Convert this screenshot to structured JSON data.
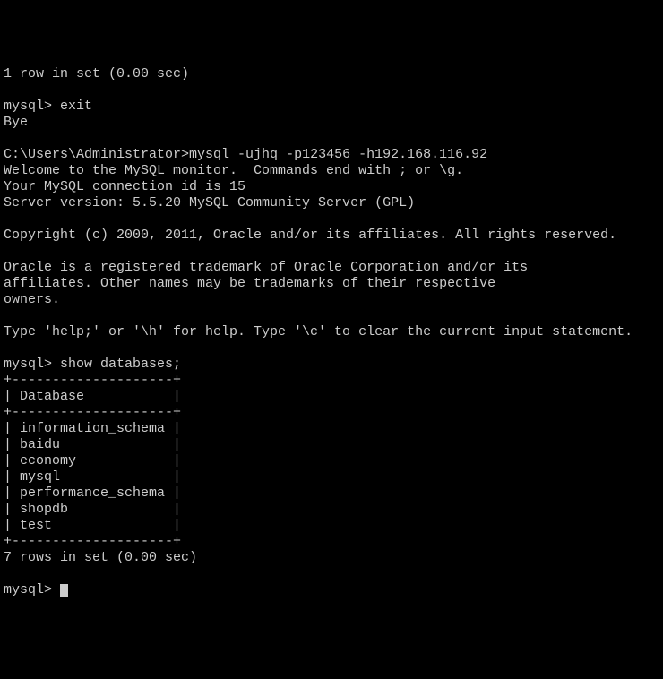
{
  "lines": {
    "l0": "1 row in set (0.00 sec)",
    "l1": "",
    "l2_prompt": "mysql> ",
    "l2_cmd": "exit",
    "l3": "Bye",
    "l4": "",
    "l5_prompt": "C:\\Users\\Administrator>",
    "l5_cmd": "mysql -ujhq -p123456 -h192.168.116.92",
    "l6": "Welcome to the MySQL monitor.  Commands end with ; or \\g.",
    "l7": "Your MySQL connection id is 15",
    "l8": "Server version: 5.5.20 MySQL Community Server (GPL)",
    "l9": "",
    "l10": "Copyright (c) 2000, 2011, Oracle and/or its affiliates. All rights reserved.",
    "l11": "",
    "l12": "Oracle is a registered trademark of Oracle Corporation and/or its",
    "l13": "affiliates. Other names may be trademarks of their respective",
    "l14": "owners.",
    "l15": "",
    "l16": "Type 'help;' or '\\h' for help. Type '\\c' to clear the current input statement.",
    "l17": "",
    "l18_prompt": "mysql> ",
    "l18_cmd": "show databases;",
    "t_border": "+--------------------+",
    "t_header": "| Database           |",
    "t_row1": "| information_schema |",
    "t_row2": "| baidu              |",
    "t_row3": "| economy            |",
    "t_row4": "| mysql              |",
    "t_row5": "| performance_schema |",
    "t_row6": "| shopdb             |",
    "t_row7": "| test               |",
    "summary": "7 rows in set (0.00 sec)",
    "blank": "",
    "final_prompt": "mysql> "
  }
}
